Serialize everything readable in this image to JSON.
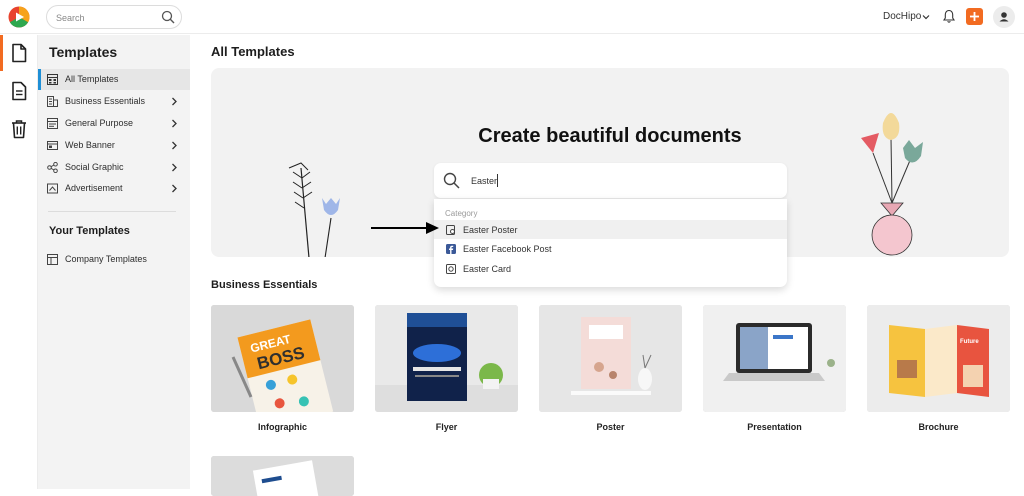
{
  "topbar": {
    "search_placeholder": "Search",
    "brand": "DocHipo",
    "accent_color": "#f26b21",
    "icons": [
      "dochipo-logo-icon",
      "search-icon",
      "chevron-down-icon",
      "bell-icon",
      "plus-icon",
      "user-avatar-icon"
    ]
  },
  "rail": {
    "items": [
      "document-icon",
      "file-text-icon",
      "trash-icon"
    ]
  },
  "sidebar": {
    "title": "Templates",
    "items": [
      {
        "label": "All Templates",
        "icon": "grid-icon",
        "active": true
      },
      {
        "label": "Business Essentials",
        "icon": "building-icon"
      },
      {
        "label": "General Purpose",
        "icon": "layout-icon"
      },
      {
        "label": "Web Banner",
        "icon": "banner-icon"
      },
      {
        "label": "Social Graphic",
        "icon": "social-icon"
      },
      {
        "label": "Advertisement",
        "icon": "advertisement-icon"
      }
    ],
    "your_templates_title": "Your Templates",
    "your_templates_items": [
      {
        "label": "Company Templates",
        "icon": "company-icon"
      }
    ]
  },
  "main": {
    "title": "All Templates",
    "hero": {
      "title": "Create beautiful documents",
      "search_value": "Easter"
    },
    "dropdown": {
      "header": "Category",
      "items": [
        {
          "label": "Easter Poster",
          "icon": "poster-icon",
          "highlighted": true
        },
        {
          "label": "Easter Facebook Post",
          "icon": "facebook-icon"
        },
        {
          "label": "Easter Card",
          "icon": "card-icon"
        }
      ]
    },
    "section_title": "Business Essentials",
    "cards": [
      {
        "label": "Infographic"
      },
      {
        "label": "Flyer"
      },
      {
        "label": "Poster"
      },
      {
        "label": "Presentation"
      },
      {
        "label": "Brochure"
      }
    ]
  }
}
